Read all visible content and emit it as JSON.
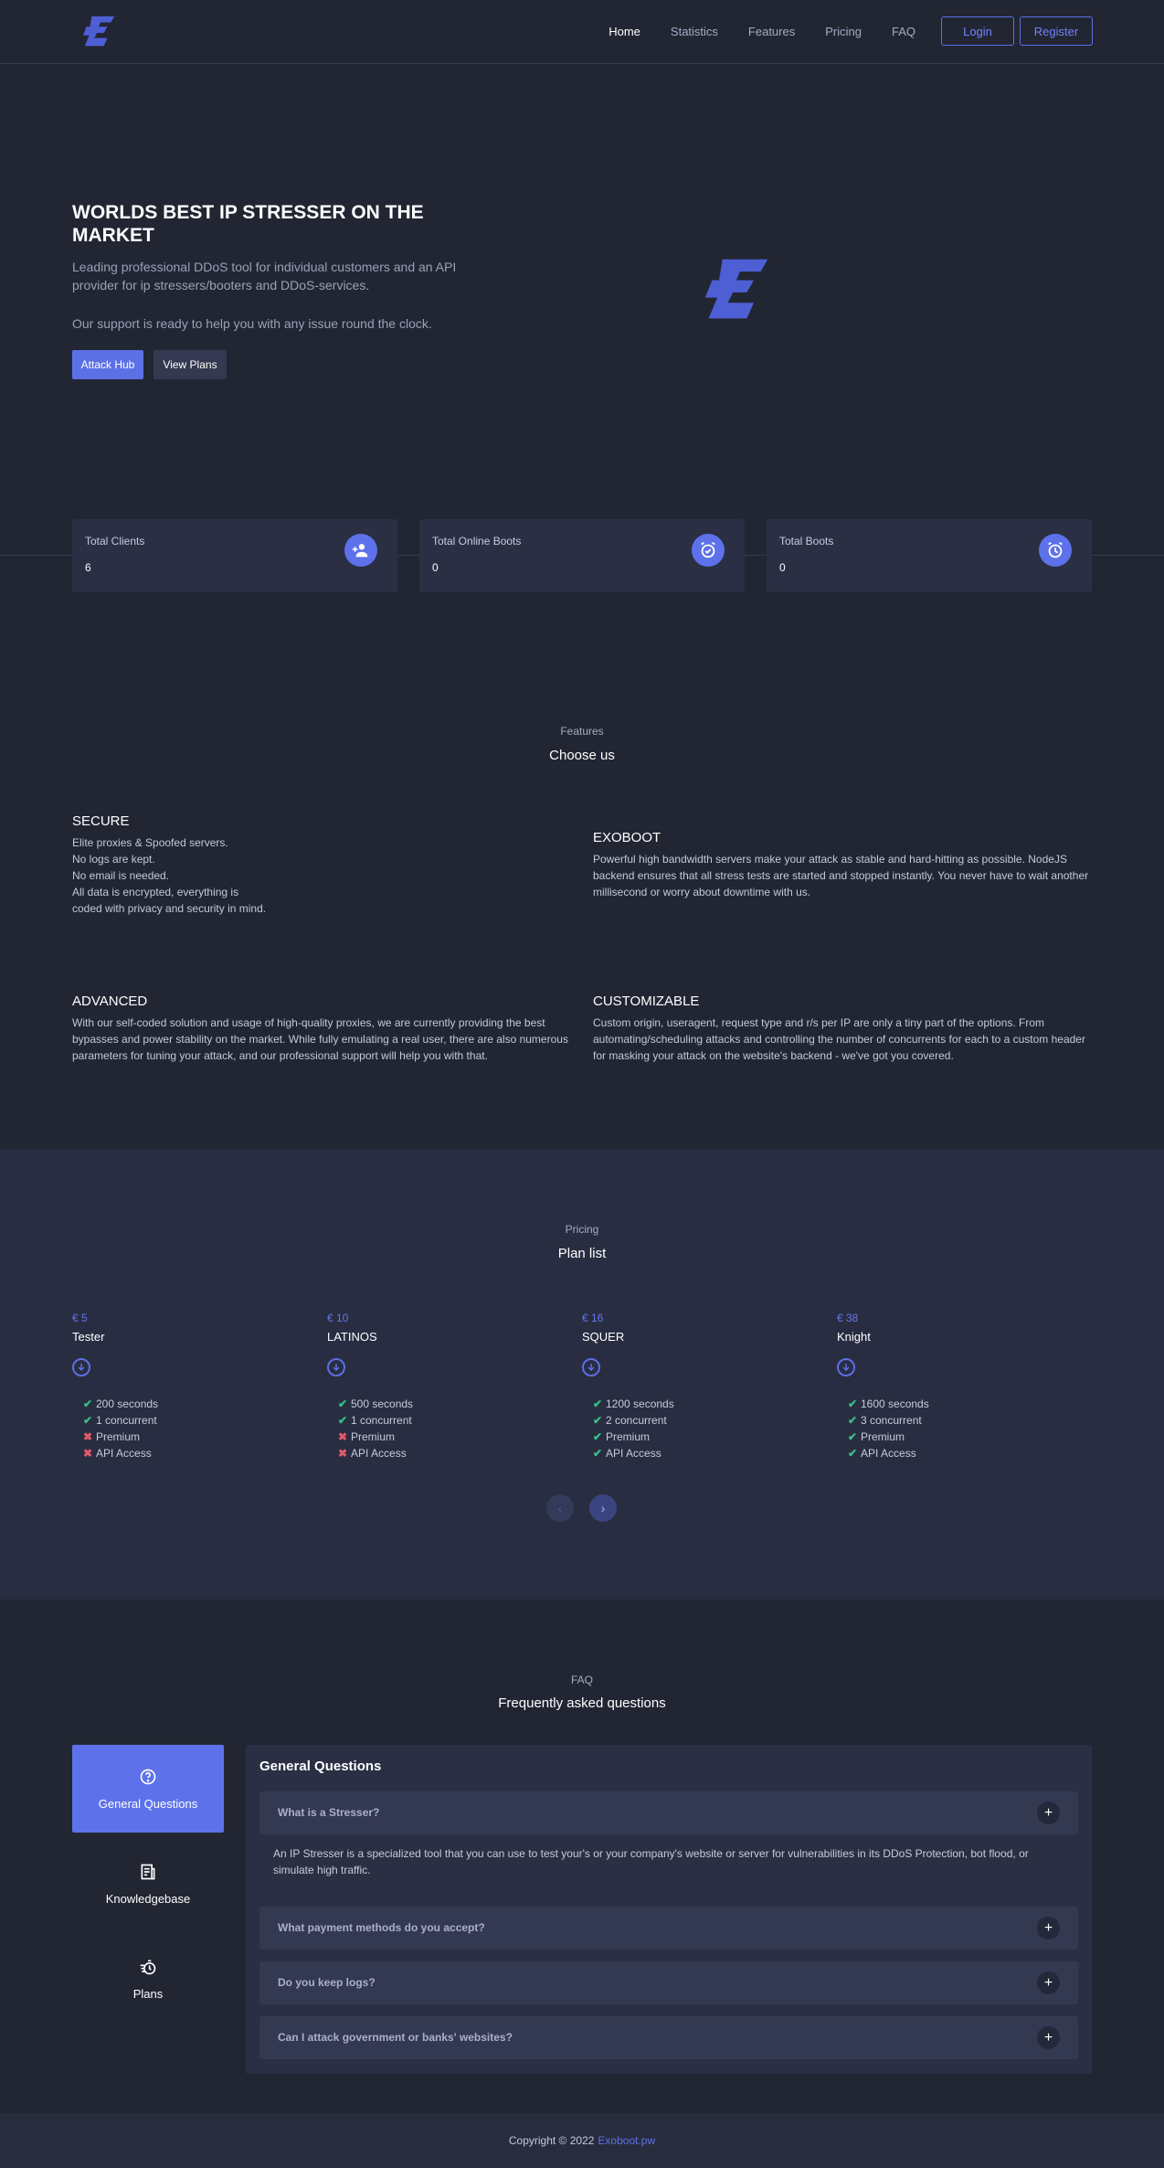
{
  "nav": {
    "links": [
      "Home",
      "Statistics",
      "Features",
      "Pricing",
      "FAQ"
    ],
    "login": "Login",
    "register": "Register"
  },
  "hero": {
    "title": "WORLDS BEST IP STRESSER ON THE MARKET",
    "description": "Leading professional DDoS tool for individual customers and an API provider for ip stressers/booters and DDoS-services.",
    "support": "Our support is ready to help you with any issue round the clock.",
    "primary_button": "Attack Hub",
    "secondary_button": "View Plans"
  },
  "stats": [
    {
      "label": "Total Clients",
      "value": "6",
      "icon": "users-plus-icon"
    },
    {
      "label": "Total Online Boots",
      "value": "0",
      "icon": "alarm-check-icon"
    },
    {
      "label": "Total Boots",
      "value": "0",
      "icon": "clock-icon"
    }
  ],
  "features": {
    "kicker": "Features",
    "title": "Choose us",
    "items": [
      {
        "title": "SECURE",
        "text": "Elite proxies & Spoofed servers.\nNo logs are kept.\nNo email is needed.\nAll data is encrypted, everything is\ncoded with privacy and security in mind."
      },
      {
        "title": "EXOBOOT",
        "text": "Powerful high bandwidth servers make your attack as stable and hard-hitting as possible. NodeJS backend ensures that all stress tests are started and stopped instantly. You never have to wait another millisecond or worry about downtime with us."
      },
      {
        "title": "ADVANCED",
        "text": "With our self-coded solution and usage of high-quality proxies, we are currently providing the best bypasses and power stability on the market. While fully emulating a real user, there are also numerous parameters for tuning your attack, and our professional support will help you with that."
      },
      {
        "title": "CUSTOMIZABLE",
        "text": "Custom origin, useragent, request type and r/s per IP are only a tiny part of the options. From automating/scheduling attacks and controlling the number of concurrents for each to a custom header for masking your attack on the website's backend - we've got you covered."
      }
    ]
  },
  "pricing": {
    "kicker": "Pricing",
    "title": "Plan list",
    "plans": [
      {
        "price": "€ 5",
        "name": "Tester",
        "features": [
          {
            "text": "200 seconds",
            "ok": true
          },
          {
            "text": "1 concurrent",
            "ok": true
          },
          {
            "text": "Premium",
            "ok": false
          },
          {
            "text": "API Access",
            "ok": false
          }
        ]
      },
      {
        "price": "€ 10",
        "name": "LATINOS",
        "features": [
          {
            "text": "500 seconds",
            "ok": true
          },
          {
            "text": "1 concurrent",
            "ok": true
          },
          {
            "text": "Premium",
            "ok": false
          },
          {
            "text": "API Access",
            "ok": false
          }
        ]
      },
      {
        "price": "€ 16",
        "name": "SQUER",
        "features": [
          {
            "text": "1200 seconds",
            "ok": true
          },
          {
            "text": "2 concurrent",
            "ok": true
          },
          {
            "text": "Premium",
            "ok": true
          },
          {
            "text": "API Access",
            "ok": true
          }
        ]
      },
      {
        "price": "€ 38",
        "name": "Knight",
        "features": [
          {
            "text": "1600 seconds",
            "ok": true
          },
          {
            "text": "3 concurrent",
            "ok": true
          },
          {
            "text": "Premium",
            "ok": true
          },
          {
            "text": "API Access",
            "ok": true
          }
        ]
      }
    ]
  },
  "faq": {
    "kicker": "FAQ",
    "title": "Frequently asked questions",
    "tabs": [
      {
        "label": "General Questions",
        "icon": "question-circle-icon"
      },
      {
        "label": "Knowledgebase",
        "icon": "document-icon"
      },
      {
        "label": "Plans",
        "icon": "stopwatch-icon"
      }
    ],
    "panel_title": "General Questions",
    "questions": [
      "What is a Stresser?",
      "What payment methods do you accept?",
      "Do you keep logs?",
      "Can I attack government or banks' websites?"
    ],
    "answer": "An IP Stresser is a specialized tool that you can use to test your's or your company's website or server for vulnerabilities in its DDoS Protection, bot flood, or simulate high traffic."
  },
  "footer": {
    "copyright": "Copyright © 2022",
    "link": "Exoboot.pw"
  },
  "colors": {
    "background": "#222633",
    "accent": "#5d72ea",
    "card": "#2a2f43",
    "check": "#35c08a",
    "cross": "#e05a6a"
  }
}
